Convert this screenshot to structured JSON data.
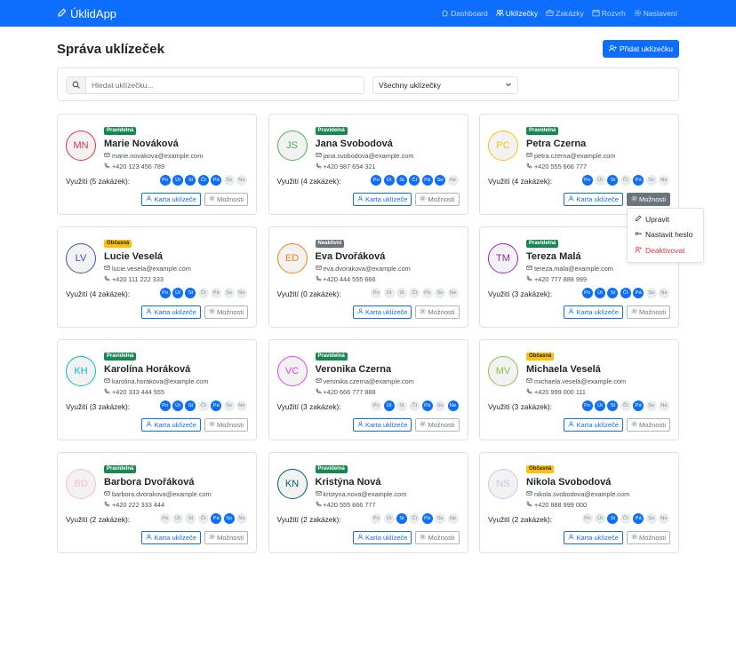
{
  "app": {
    "brand": "ÚklidApp"
  },
  "nav": [
    {
      "label": "Dashboard",
      "icon": "house-icon",
      "active": false
    },
    {
      "label": "Uklízečky",
      "icon": "people-icon",
      "active": true
    },
    {
      "label": "Zakázky",
      "icon": "briefcase-icon",
      "active": false
    },
    {
      "label": "Rozvrh",
      "icon": "calendar-icon",
      "active": false
    },
    {
      "label": "Nastavení",
      "icon": "gear-icon",
      "active": false
    }
  ],
  "page": {
    "title": "Správa uklízeček",
    "add_button": "Přidat uklízečku"
  },
  "filter": {
    "search_placeholder": "Hledat uklízečku...",
    "search_value": "",
    "select_value": "Všechny uklízečky"
  },
  "day_labels": [
    "Po",
    "Út",
    "St",
    "Čt",
    "Pá",
    "So",
    "Ne"
  ],
  "card_labels": {
    "profile_button": "Karta uklízeče",
    "options_button": "Možnosti"
  },
  "colors": {
    "primary": "#0d6efd",
    "success": "#198754",
    "warning": "#ffc107",
    "neutral": "#6c757d",
    "danger": "#dc3545"
  },
  "cleaners": [
    {
      "initials": "MN",
      "name": "Marie Nováková",
      "email": "marie.novakova@example.com",
      "phone": "+420 123 456 789",
      "badge": "Pravidelná",
      "badge_color": "#198754",
      "avatar_color": "#dc3545",
      "utilization": "Využití (5 zakázek):",
      "days": [
        1,
        1,
        1,
        1,
        1,
        0,
        0
      ]
    },
    {
      "initials": "JS",
      "name": "Jana Svobodová",
      "email": "jana.svobodova@example.com",
      "phone": "+420 987 654 321",
      "badge": "Pravidelná",
      "badge_color": "#198754",
      "avatar_color": "#4caf50",
      "utilization": "Využití (4 zakázek):",
      "days": [
        1,
        1,
        1,
        1,
        1,
        1,
        0
      ]
    },
    {
      "initials": "PC",
      "name": "Petra Czerna",
      "email": "petra.czerna@example.com",
      "phone": "+420 555 666 777",
      "badge": "Pravidelná",
      "badge_color": "#198754",
      "avatar_color": "#ffc107",
      "utilization": "Využití (4 zakázek):",
      "days": [
        1,
        0,
        1,
        0,
        1,
        0,
        0
      ],
      "options_open": true
    },
    {
      "initials": "LV",
      "name": "Lucie Veselá",
      "email": "lucie.vesela@example.com",
      "phone": "+420 111 222 333",
      "badge": "Občasná",
      "badge_color": "#ffc107",
      "avatar_color": "#3f51b5",
      "utilization": "Využití (4 zakázek):",
      "days": [
        1,
        1,
        1,
        0,
        0,
        0,
        0
      ]
    },
    {
      "initials": "ED",
      "name": "Eva Dvořáková",
      "email": "eva.dvorakova@example.com",
      "phone": "+420 444 555 666",
      "badge": "Neaktivní",
      "badge_color": "#6c757d",
      "avatar_color": "#fd7e14",
      "utilization": "Využití (0 zakázek):",
      "days": [
        0,
        0,
        0,
        0,
        0,
        0,
        0
      ]
    },
    {
      "initials": "TM",
      "name": "Tereza Malá",
      "email": "tereza.mala@example.com",
      "phone": "+420 777 888 999",
      "badge": "Pravidelná",
      "badge_color": "#198754",
      "avatar_color": "#9c27b0",
      "utilization": "Využití (3 zakázek):",
      "days": [
        1,
        1,
        1,
        1,
        1,
        0,
        0
      ]
    },
    {
      "initials": "KH",
      "name": "Karolína Horáková",
      "email": "karolina.horakova@example.com",
      "phone": "+420 333 444 555",
      "badge": "Pravidelná",
      "badge_color": "#198754",
      "avatar_color": "#00bcd4",
      "utilization": "Využití (3 zakázek):",
      "days": [
        1,
        1,
        1,
        0,
        1,
        0,
        0
      ]
    },
    {
      "initials": "VC",
      "name": "Veronika Czerna",
      "email": "veronika.czerna@example.com",
      "phone": "+420 666 777 888",
      "badge": "Pravidelná",
      "badge_color": "#198754",
      "avatar_color": "#e040fb",
      "utilization": "Využití (3 zakázek):",
      "days": [
        0,
        1,
        0,
        0,
        1,
        0,
        1
      ]
    },
    {
      "initials": "MV",
      "name": "Michaela Veselá",
      "email": "michaela.vesela@example.com",
      "phone": "+420 999 000 111",
      "badge": "Občasná",
      "badge_color": "#ffc107",
      "avatar_color": "#8bc34a",
      "utilization": "Využití (3 zakázek):",
      "days": [
        1,
        1,
        1,
        0,
        1,
        0,
        0
      ]
    },
    {
      "initials": "BD",
      "name": "Barbora Dvořáková",
      "email": "barbora.dvorakova@example.com",
      "phone": "+420 222 333 444",
      "badge": "Pravidelná",
      "badge_color": "#198754",
      "avatar_color": "#f8bbd0",
      "utilization": "Využití (2 zakázek):",
      "days": [
        0,
        0,
        0,
        0,
        1,
        1,
        0
      ]
    },
    {
      "initials": "KN",
      "name": "Kristýna Nová",
      "email": "kristyna.nova@example.com",
      "phone": "+420 555 666 777",
      "badge": "Pravidelná",
      "badge_color": "#198754",
      "avatar_color": "#006064",
      "utilization": "Využití (2 zakázek):",
      "days": [
        0,
        0,
        1,
        0,
        1,
        0,
        0
      ]
    },
    {
      "initials": "NS",
      "name": "Nikola Svobodová",
      "email": "nikola.svobodova@example.com",
      "phone": "+420 888 999 000",
      "badge": "Občasná",
      "badge_color": "#ffc107",
      "avatar_color": "#d1c4e9",
      "utilization": "Využití (2 zakázek):",
      "days": [
        0,
        0,
        1,
        0,
        1,
        0,
        0
      ]
    }
  ],
  "options_menu": [
    {
      "label": "Upravit",
      "icon": "pencil-icon",
      "danger": false
    },
    {
      "label": "Nastavit heslo",
      "icon": "key-icon",
      "danger": false
    },
    {
      "label": "Deaktivovat",
      "icon": "person-x-icon",
      "danger": true
    }
  ]
}
